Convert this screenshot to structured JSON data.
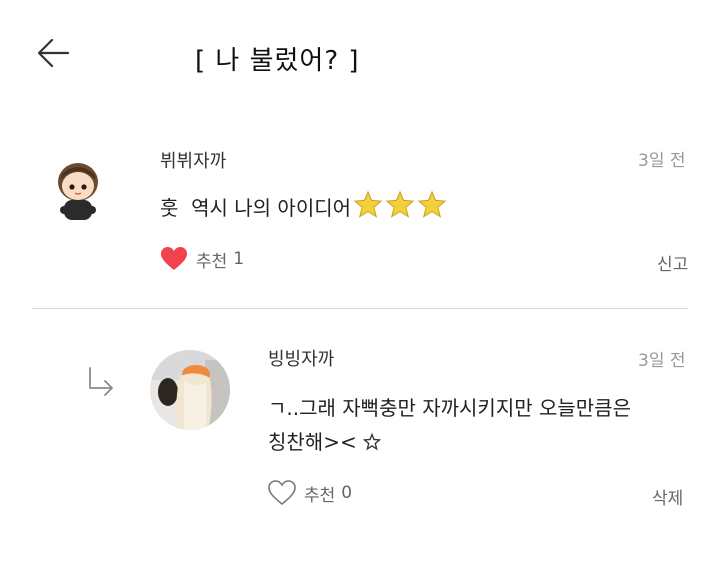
{
  "header": {
    "title": "[ 나 불렀어? ]",
    "back_icon": "arrow-left-icon"
  },
  "comment": {
    "username": "뷔뷔자까",
    "time": "3일 전",
    "text": "훗  역시 나의 아이디어",
    "stars": 3,
    "like_label": "추천",
    "like_count": "1",
    "liked": true,
    "report_label": "신고",
    "heart_color": "#f0434b",
    "star_color": "#f3d03e"
  },
  "reply": {
    "reply_icon": "reply-arrow-icon",
    "username": "빙빙자까",
    "time": "3일 전",
    "text_line1": "ㄱ..그래 자뻑충만 자까시키지만 오늘만큼은",
    "text_line2": "칭찬해><",
    "like_label": "추천",
    "like_count": "0",
    "liked": false,
    "delete_label": "삭제"
  }
}
